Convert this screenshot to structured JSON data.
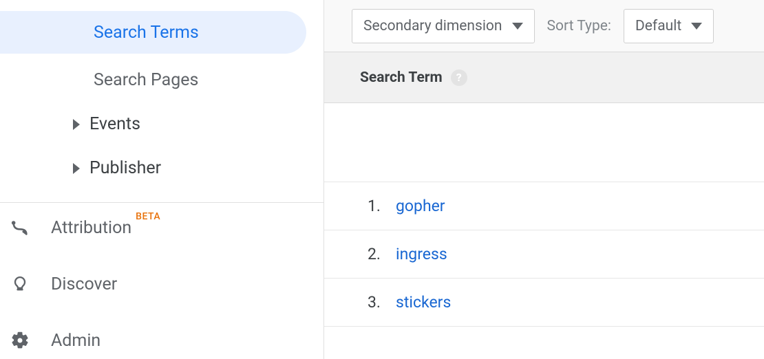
{
  "sidebar": {
    "active_item": "Search Terms",
    "search_pages": "Search Pages",
    "events": "Events",
    "publisher": "Publisher",
    "attribution": {
      "label": "Attribution",
      "badge": "BETA"
    },
    "discover": "Discover",
    "admin": "Admin"
  },
  "toolbar": {
    "secondary_dimension_label": "Secondary dimension",
    "sort_type_label": "Sort Type:",
    "sort_default": "Default"
  },
  "table": {
    "column_header": "Search Term",
    "help_glyph": "?",
    "rows": [
      {
        "index": "1.",
        "term": "gopher"
      },
      {
        "index": "2.",
        "term": "ingress"
      },
      {
        "index": "3.",
        "term": "stickers"
      }
    ]
  }
}
